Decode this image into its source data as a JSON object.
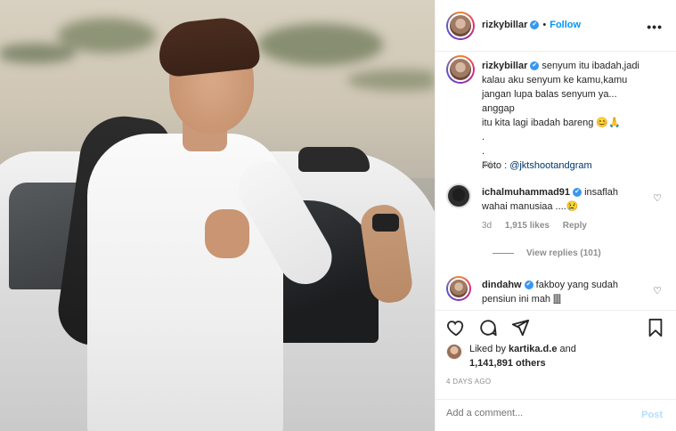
{
  "post_owner": {
    "username": "rizkybillar",
    "verified_mark": "✔",
    "follow_label": "Follow",
    "separator": "•",
    "more_label": "•••"
  },
  "caption": {
    "username": "rizkybillar",
    "text_lines": [
      "senyum itu ibadah,jadi",
      "kalau aku senyum ke kamu,kamu",
      "jangan lupa balas senyum ya... anggap",
      "itu kita lagi ibadah bareng 😊🙏",
      ".",
      ".",
      "Foto : @jktshootandgram"
    ],
    "foto_prefix": "Foto : ",
    "foto_mention": "@jktshootandgram",
    "age": "4d"
  },
  "comments": [
    {
      "username": "ichalmuhammad91",
      "text_line1": "insaflah",
      "text_line2": "wahai manusiaa ....😢",
      "age": "3d",
      "likes": "1,915 likes",
      "reply": "Reply",
      "view_replies": "View replies (101)"
    },
    {
      "username": "dindahw",
      "text_line1": "fakboy yang sudah",
      "text_line2": "pensiun ini mah 🀫"
    }
  ],
  "actions": {
    "like_icon": "heart-icon",
    "comment_icon": "comment-icon",
    "share_icon": "share-icon",
    "save_icon": "bookmark-icon"
  },
  "likes": {
    "prefix": "Liked by ",
    "user": "kartika.d.e",
    "and": " and",
    "count": "1,141,891 others"
  },
  "date": "4 DAYS AGO",
  "add_comment": {
    "placeholder": "Add a comment...",
    "post_label": "Post"
  },
  "colors": {
    "accent": "#0095f6",
    "verified": "#3897f0",
    "muted": "#8e8e8e",
    "post_disabled": "#b2dffc"
  }
}
